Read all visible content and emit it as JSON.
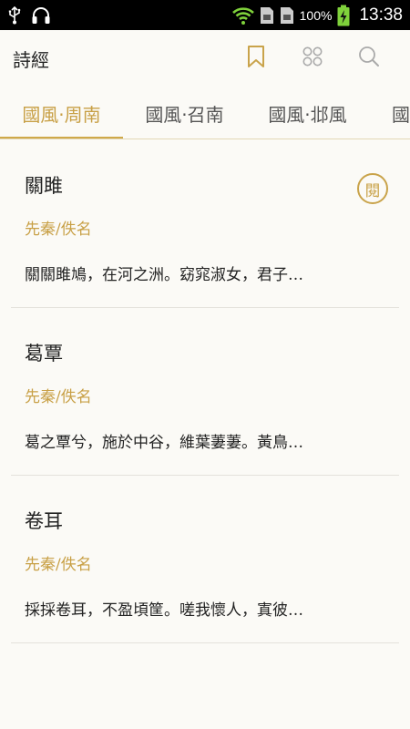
{
  "status_bar": {
    "battery": "100%",
    "time": "13:38",
    "icons": [
      "usb-icon",
      "headset-icon",
      "wifi-icon",
      "sim1-icon",
      "sim2-icon",
      "battery-charging-icon"
    ]
  },
  "header": {
    "title": "詩經",
    "actions": [
      "bookmark-icon",
      "grid-icon",
      "search-icon"
    ]
  },
  "tabs": [
    {
      "label": "國風·周南",
      "active": true
    },
    {
      "label": "國風·召南",
      "active": false
    },
    {
      "label": "國風·邶風",
      "active": false
    },
    {
      "label": "國",
      "active": false
    }
  ],
  "poems": [
    {
      "title": "關雎",
      "meta": "先秦/佚名",
      "excerpt": "關關雎鳩，在河之洲。窈窕淑女，君子…",
      "badge": "閱"
    },
    {
      "title": "葛覃",
      "meta": "先秦/佚名",
      "excerpt": "葛之覃兮，施於中谷，維葉萋萋。黃鳥…"
    },
    {
      "title": "卷耳",
      "meta": "先秦/佚名",
      "excerpt": "採採卷耳，不盈頃筐。嗟我懷人，寘彼…"
    }
  ],
  "colors": {
    "accent": "#c8a046",
    "background": "#fbfaf6",
    "status_bar": "#000000"
  }
}
